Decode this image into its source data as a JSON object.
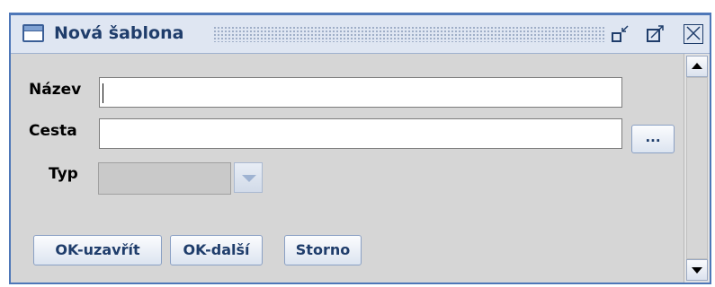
{
  "window": {
    "title": "Nová šablona",
    "icon": "window-icon",
    "controls": {
      "iconify": "iconify-icon",
      "maximize": "maximize-icon",
      "close": "close-icon"
    }
  },
  "form": {
    "name_label": "Název",
    "name_value": "",
    "path_label": "Cesta",
    "path_value": "",
    "browse_label": "...",
    "type_label": "Typ",
    "type_value": ""
  },
  "buttons": {
    "ok_close": "OK-uzavřít",
    "ok_next": "OK-další",
    "cancel": "Storno"
  },
  "colors": {
    "accent": "#4e77b8",
    "title_text": "#1f3d6b",
    "panel": "#d6d6d6"
  }
}
